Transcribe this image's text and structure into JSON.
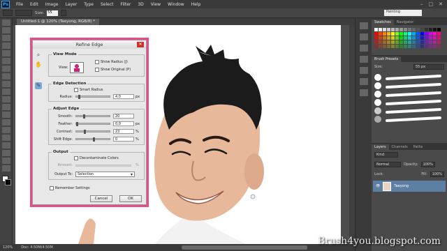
{
  "app": {
    "logo": "Ps",
    "menu": [
      "File",
      "Edit",
      "Image",
      "Layer",
      "Type",
      "Select",
      "Filter",
      "3D",
      "View",
      "Window",
      "Help"
    ],
    "window_controls": [
      "–",
      "□",
      "✕"
    ]
  },
  "options_bar": {
    "size_label": "Size:",
    "size_value": "55",
    "workspace": "Painting"
  },
  "document": {
    "tab_label": "Untitled-1 @ 120% (Taeyong, RGB/8) *"
  },
  "status_bar": {
    "zoom": "120%",
    "doc_info": "Doc: 4.50M/4.50M"
  },
  "panels": {
    "swatches_tabs": [
      "Swatches",
      "Navigator"
    ],
    "brush_panel_tab": "Brush Presets",
    "brush_size_label": "Size:",
    "brush_size_value": "55 px",
    "layers_tabs": [
      "Layers",
      "Channels",
      "Paths"
    ],
    "kind_label": "Kind",
    "blend_mode": "Normal",
    "opacity_label": "Opacity:",
    "opacity_value": "100%",
    "lock_label": "Lock:",
    "fill_label": "Fill:",
    "fill_value": "100%",
    "layer_name": "Taeyong"
  },
  "dialog": {
    "title": "Refine Edge",
    "view_mode": {
      "title": "View Mode",
      "view_label": "View:",
      "show_radius": "Show Radius (J)",
      "show_original": "Show Original (P)"
    },
    "edge_detection": {
      "title": "Edge Detection",
      "smart_radius": "Smart Radius",
      "radius_label": "Radius:",
      "radius_value": "4.0",
      "radius_unit": "px"
    },
    "adjust_edge": {
      "title": "Adjust Edge",
      "smooth_label": "Smooth:",
      "smooth_value": "20",
      "feather_label": "Feather:",
      "feather_value": "0.0",
      "feather_unit": "px",
      "contrast_label": "Contrast:",
      "contrast_value": "23",
      "contrast_unit": "%",
      "shift_label": "Shift Edge:",
      "shift_value": "0",
      "shift_unit": "%"
    },
    "output": {
      "title": "Output",
      "decontaminate": "Decontaminate Colors",
      "amount_label": "Amount:",
      "amount_unit": "%",
      "output_to_label": "Output To:",
      "output_to_value": "Selection"
    },
    "remember": "Remember Settings",
    "cancel": "Cancel",
    "ok": "OK"
  },
  "watermark": "Brush4you.blogspot.com",
  "colors": {
    "dialog_border": "#e84d8a",
    "active_tool": "#7aa9d6",
    "selected_layer": "#5d7fa3"
  }
}
